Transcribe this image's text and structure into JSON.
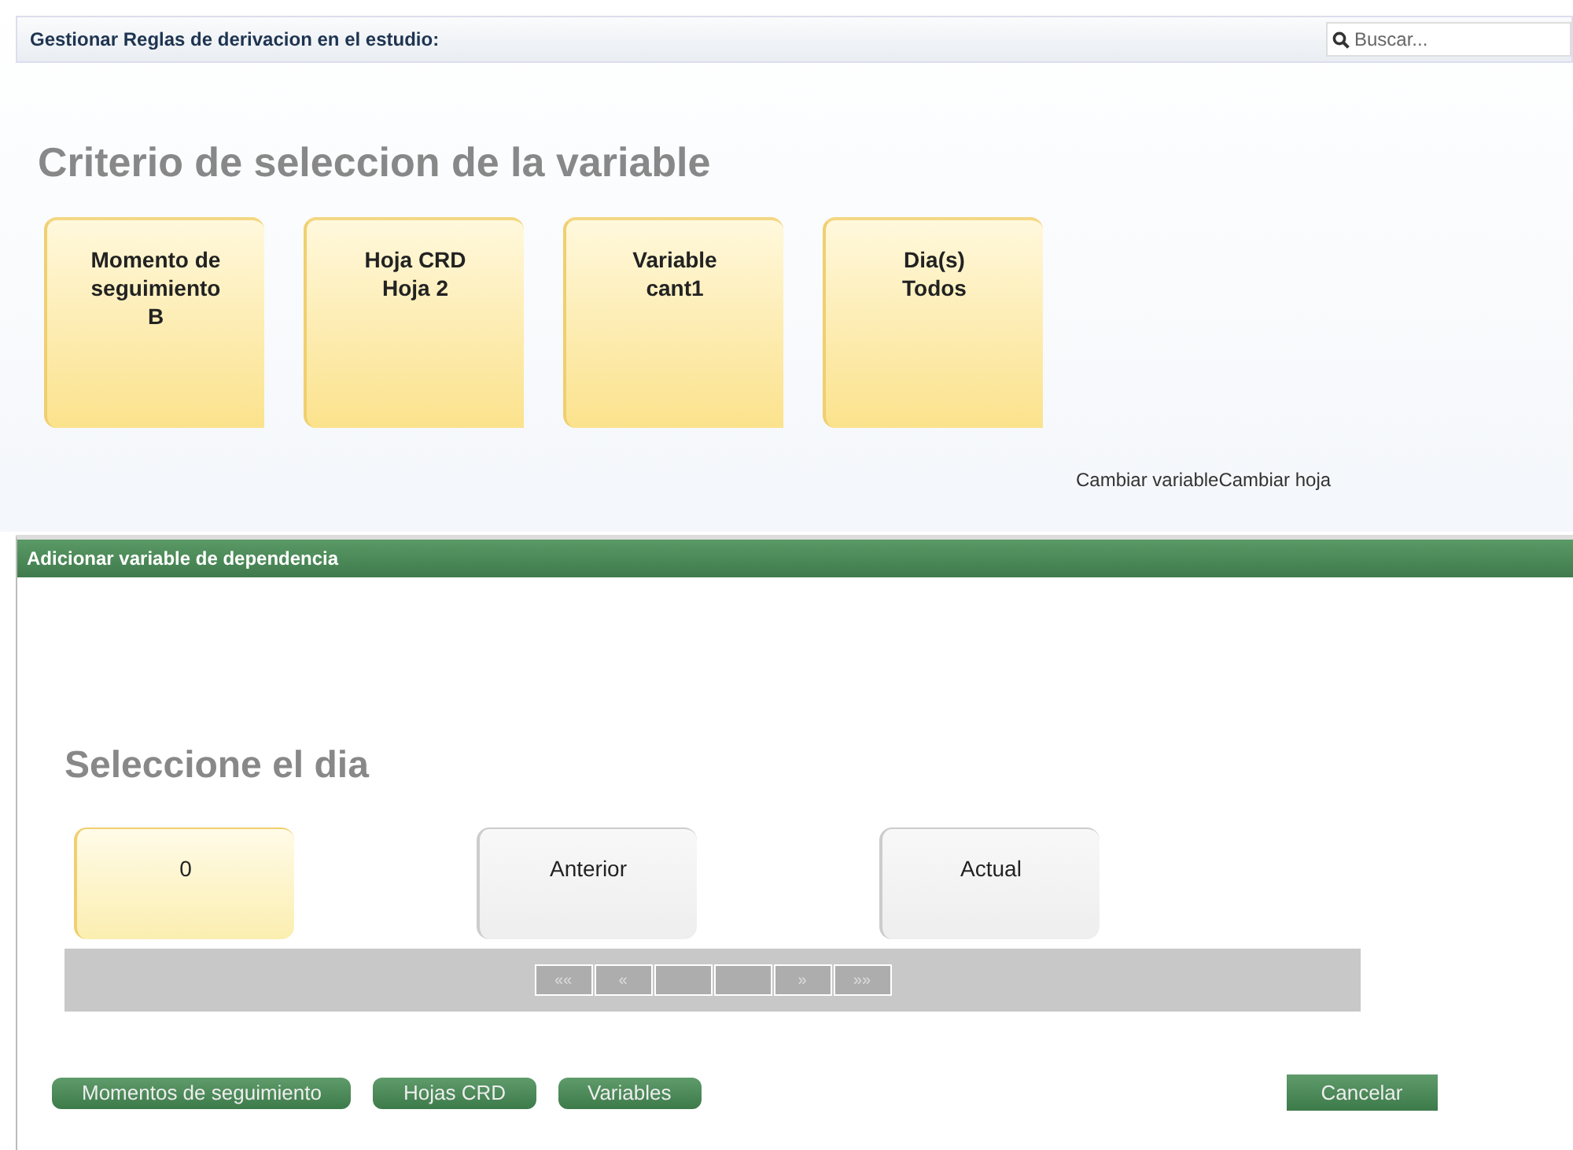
{
  "header": {
    "title": "Gestionar Reglas de derivacion en el estudio:",
    "search": {
      "placeholder": "Buscar..."
    }
  },
  "criteria": {
    "heading": "Criterio de seleccion de la variable",
    "cards": [
      {
        "lines": [
          "Momento de",
          "seguimiento",
          "B"
        ]
      },
      {
        "lines": [
          "Hoja CRD",
          "Hoja 2"
        ]
      },
      {
        "lines": [
          "Variable",
          "cant1"
        ]
      },
      {
        "lines": [
          "Dia(s)",
          "Todos"
        ]
      }
    ],
    "links": [
      "Cambiar variable",
      "Cambiar hoja"
    ]
  },
  "dialog": {
    "title": "Adicionar variable de dependencia",
    "heading": "Seleccione el dia",
    "days": [
      {
        "label": "0",
        "selected": true
      },
      {
        "label": "Anterior",
        "selected": false
      },
      {
        "label": "Actual",
        "selected": false
      }
    ],
    "pager": {
      "first": "««",
      "prev": "«",
      "next": "»",
      "last": "»»"
    },
    "buttons": [
      "Momentos de seguimiento",
      "Hojas CRD",
      "Variables"
    ],
    "cancel": "Cancelar"
  }
}
